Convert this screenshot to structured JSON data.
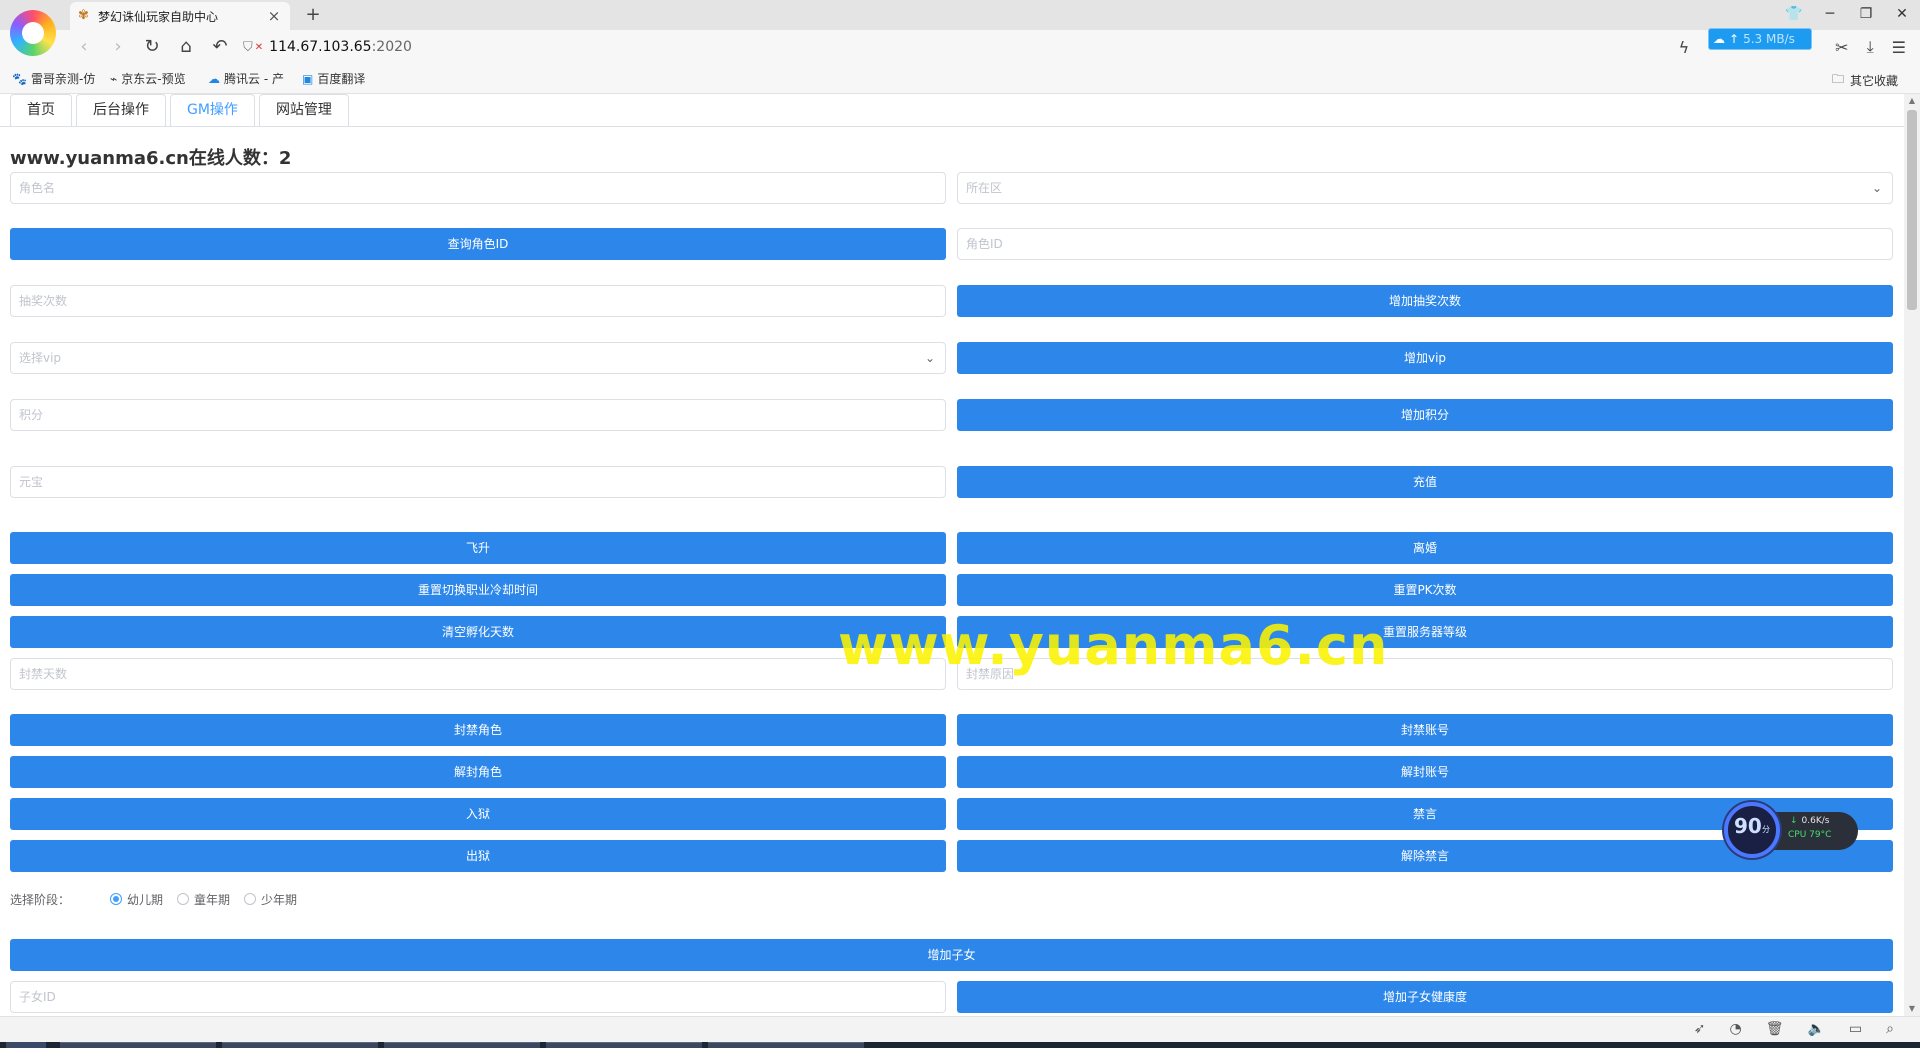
{
  "browser": {
    "tab_title": "梦幻诛仙玩家自助中心",
    "tab_close": "×",
    "new_tab": "+",
    "url_host": "114.67.103.65",
    "url_port": ":2020",
    "speed": "5.3 MB/s",
    "speed_arrow": "↑",
    "bookmarks": [
      "雷哥亲测-仿",
      "京东云-预览",
      "腾讯云 - 产",
      "百度翻译"
    ],
    "other_bookmarks": "其它收藏"
  },
  "page": {
    "tabs": [
      {
        "label": "首页",
        "active": false
      },
      {
        "label": "后台操作",
        "active": false
      },
      {
        "label": "GM操作",
        "active": true
      },
      {
        "label": "网站管理",
        "active": false
      }
    ],
    "online_label": "www.yuanma6.cn在线人数：",
    "online_count": "2",
    "role_name_placeholder": "角色名",
    "server_placeholder": "所在区",
    "query_role_id": "查询角色ID",
    "role_id_placeholder": "角色ID",
    "lottery_placeholder": "抽奖次数",
    "add_lottery": "增加抽奖次数",
    "vip_placeholder": "选择vip",
    "add_vip": "增加vip",
    "points_placeholder": "积分",
    "add_points": "增加积分",
    "yuanbao_placeholder": "元宝",
    "recharge": "充值",
    "ascend": "飞升",
    "divorce": "离婚",
    "reset_job_cd": "重置切换职业冷却时间",
    "reset_pk": "重置PK次数",
    "clear_incubate": "清空孵化天数",
    "reset_server_level": "重置服务器等级",
    "ban_days_placeholder": "封禁天数",
    "ban_reason_placeholder": "封禁原因",
    "ban_role": "封禁角色",
    "ban_account": "封禁账号",
    "unban_role": "解封角色",
    "unban_account": "解封账号",
    "jail": "入狱",
    "mute": "禁言",
    "release": "出狱",
    "unmute": "解除禁言",
    "stage_label": "选择阶段：",
    "stages": [
      {
        "label": "幼儿期",
        "checked": true
      },
      {
        "label": "童年期",
        "checked": false
      },
      {
        "label": "少年期",
        "checked": false
      }
    ],
    "add_child": "增加子女",
    "child_id_placeholder": "子女ID",
    "add_child_health": "增加子女健康度"
  },
  "watermark": "www.yuanma6.cn",
  "monitor": {
    "score": "90",
    "score_unit": "分",
    "net_speed": "0.6K/s",
    "cpu": "CPU 79°C"
  },
  "colors": {
    "primary_button": "#2d87ea",
    "active_tab": "#409eff",
    "watermark": "#faf200"
  }
}
